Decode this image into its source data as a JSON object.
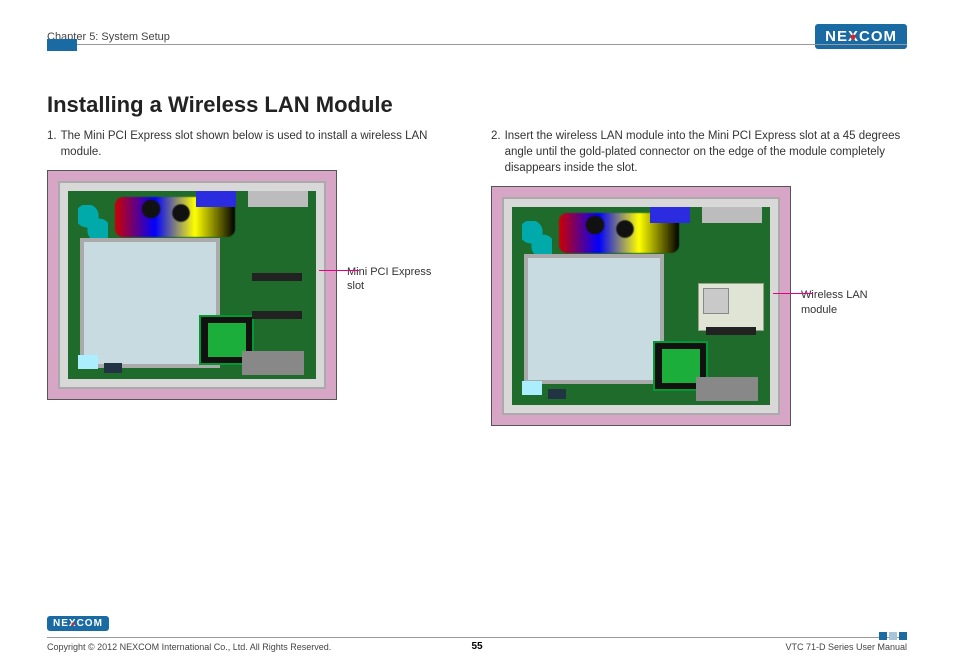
{
  "header": {
    "chapter": "Chapter 5: System Setup",
    "logo_text_pre": "NE",
    "logo_text_x": "X",
    "logo_text_post": "COM"
  },
  "title": "Installing a Wireless LAN Module",
  "steps": {
    "s1_num": "1.",
    "s1_text": "The Mini PCI Express slot shown below is used to install a wireless LAN module.",
    "s2_num": "2.",
    "s2_text": "Insert the wireless LAN module into the Mini PCI Express slot at a 45 degrees angle until the gold-plated connector on the edge of the module completely disappears inside the slot."
  },
  "annotations": {
    "a1": "Mini PCI Express slot",
    "a2": "Wireless LAN module"
  },
  "footer": {
    "copyright": "Copyright © 2012 NEXCOM International Co., Ltd. All Rights Reserved.",
    "page": "55",
    "doc": "VTC 71-D Series User Manual"
  }
}
